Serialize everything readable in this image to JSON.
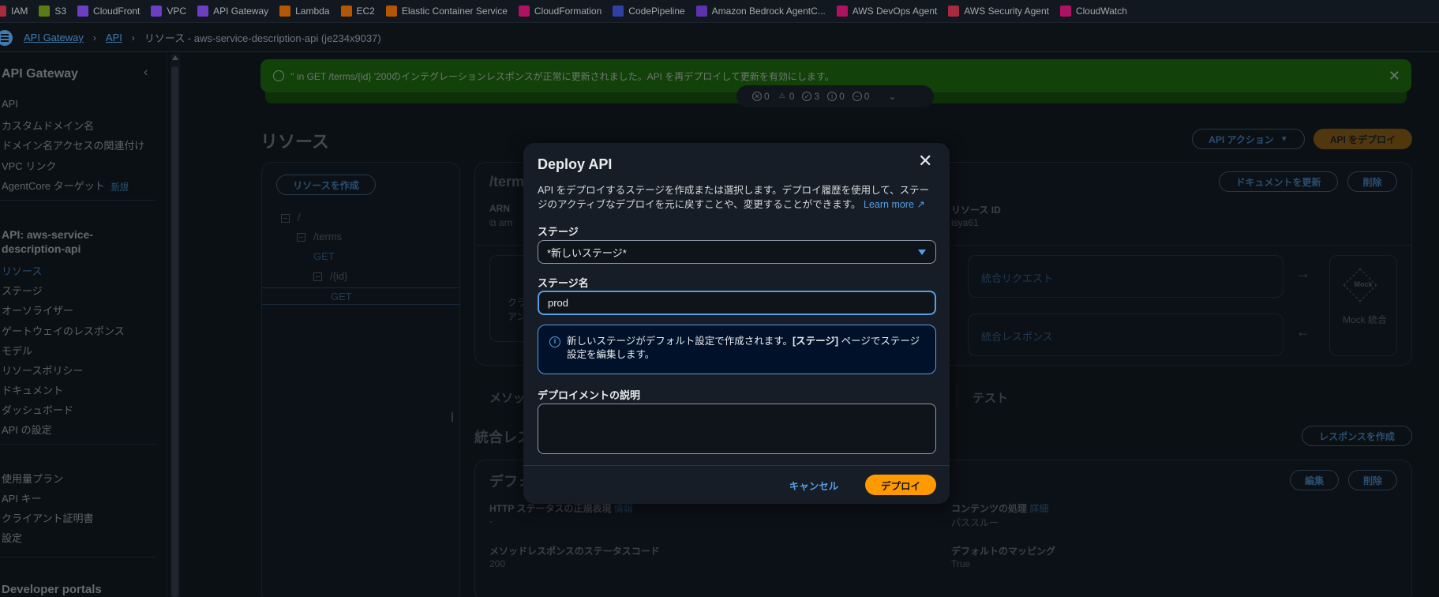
{
  "favorites": [
    {
      "label": "IAM",
      "color": "#dd344c"
    },
    {
      "label": "S3",
      "color": "#7aa116"
    },
    {
      "label": "CloudFront",
      "color": "#8c4fff"
    },
    {
      "label": "VPC",
      "color": "#8c4fff"
    },
    {
      "label": "API Gateway",
      "color": "#8c4fff"
    },
    {
      "label": "Lambda",
      "color": "#ed7100"
    },
    {
      "label": "EC2",
      "color": "#ed7100"
    },
    {
      "label": "Elastic Container Service",
      "color": "#ed7100"
    },
    {
      "label": "CloudFormation",
      "color": "#e7157b"
    },
    {
      "label": "CodePipeline",
      "color": "#3f51d9"
    },
    {
      "label": "Amazon Bedrock AgentC...",
      "color": "#7b3fe4"
    },
    {
      "label": "AWS DevOps Agent",
      "color": "#e7157b"
    },
    {
      "label": "AWS Security Agent",
      "color": "#dd344c"
    },
    {
      "label": "CloudWatch",
      "color": "#e7157b"
    }
  ],
  "breadcrumb": {
    "service": "API Gateway",
    "apis": "API",
    "current": "リソース - aws-service-description-api (je234x9037)"
  },
  "sidebar": {
    "title": "API Gateway",
    "items": [
      "API",
      "カスタムドメイン名",
      "ドメイン名アクセスの関連付け",
      "VPC リンク",
      "AgentCore ターゲット"
    ],
    "new_badge": "新規",
    "api_section_title": "API: aws-service-description-api",
    "api_items": [
      "リソース",
      "ステージ",
      "オーソライザー",
      "ゲートウェイのレスポンス",
      "モデル",
      "リソースポリシー",
      "ドキュメント",
      "ダッシュボード",
      "API の設定"
    ],
    "misc_items": [
      "使用量プラン",
      "API キー",
      "クライアント証明書",
      "設定"
    ],
    "portals_title": "Developer portals"
  },
  "flash": {
    "message": "'' in GET /terms/{id} '200のインテグレーションレスポンスが正常に更新されました。API を再デプロイして更新を有効にします。"
  },
  "counters": {
    "error": "0",
    "warning": "0",
    "success": "3",
    "info": "0",
    "pending": "0"
  },
  "resources_page": {
    "title": "リソース",
    "api_actions": "API アクション",
    "deploy_api": "API をデプロイ",
    "create_resource": "リソースを作成",
    "tree": [
      "/",
      "/terms",
      "GET",
      "/{id}",
      "GET"
    ],
    "detail_title": "/term",
    "arn_label": "ARN",
    "arn_value": "arn",
    "resource_id_label": "リソース ID",
    "resource_id_value": "isya61",
    "update_docs": "ドキュメントを更新",
    "delete": "削除",
    "integration_request": "統合リクエスト",
    "integration_response": "統合レスポンス",
    "mock": "Mock",
    "mock_integration": "Mock 統合",
    "client_partial": "クラ",
    "client_partial2": "アン",
    "tab_method": "メソッ",
    "tab_test": "テスト",
    "section_integration": "統合レス",
    "create_response": "レスポンスを作成",
    "default_title": "デフォ",
    "edit": "編集",
    "http_status_label": "HTTP ステータスの正規表現",
    "http_status_info": "情報",
    "http_status_value": "-",
    "content_handling_label": "コンテンツの処理",
    "content_handling_detail": "詳細",
    "content_handling_value": "パススルー",
    "method_status_label": "メソッドレスポンスのステータスコード",
    "method_status_value": "200",
    "default_mapping_label": "デフォルトのマッピング",
    "default_mapping_value": "True"
  },
  "modal": {
    "title": "Deploy API",
    "description": "API をデプロイするステージを作成または選択します。デプロイ履歴を使用して、ステージのアクティブなデプロイを元に戻すことや、変更することができます。",
    "learn_more": "Learn more",
    "stage_label": "ステージ",
    "stage_value": "*新しいステージ*",
    "stage_name_label": "ステージ名",
    "stage_name_value": "prod",
    "info_text_1": "新しいステージがデフォルト設定で作成されます。",
    "info_text_bold": "[ステージ]",
    "info_text_2": " ページでステージ設定を編集します。",
    "description_label": "デプロイメントの説明",
    "description_value": "",
    "cancel": "キャンセル",
    "deploy": "デプロイ"
  },
  "colors": {
    "accent": "#539fe5",
    "primary_button": "#ff9900",
    "success_banner": "#1d8102",
    "background": "#0f141a"
  }
}
